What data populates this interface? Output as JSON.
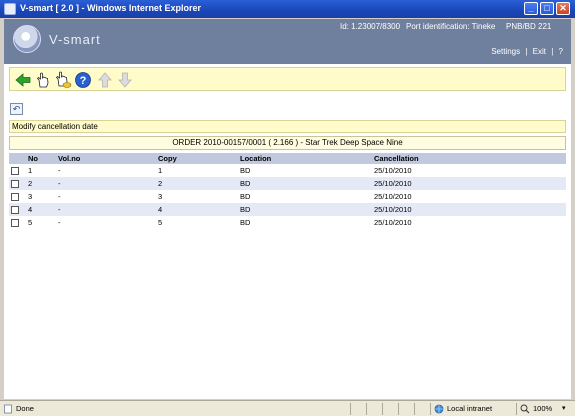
{
  "window": {
    "title": "V-smart [ 2.0 ] - Windows Internet Explorer",
    "controls": {
      "minimize": "_",
      "maximize": "□",
      "close": "✕"
    }
  },
  "banner": {
    "logo_text": "V-smart",
    "id_text": "Id: 1.23007/8300",
    "port_text": "Port identification: Tineke",
    "branch_text": "PNB/BD",
    "number_text": "221",
    "links": {
      "settings": "Settings",
      "exit": "Exit",
      "help": "?"
    },
    "separator": "|"
  },
  "toolbar": {
    "icons": [
      "back-arrow-icon",
      "hand-select-icon",
      "hand-select-all-icon",
      "help-icon",
      "up-arrow-icon",
      "down-arrow-icon"
    ]
  },
  "undo_label": "↶",
  "section_title": "Modify cancellation date",
  "order_line": "ORDER 2010-00157/0001 ( 2.166 ) - Star Trek Deep Space Nine",
  "table": {
    "headers": {
      "no": "No",
      "volno": "Vol.no",
      "copy": "Copy",
      "location": "Location",
      "cancellation": "Cancellation"
    },
    "rows": [
      {
        "no": "1",
        "volno": "-",
        "copy": "1",
        "location": "BD",
        "cancellation": "25/10/2010"
      },
      {
        "no": "2",
        "volno": "-",
        "copy": "2",
        "location": "BD",
        "cancellation": "25/10/2010"
      },
      {
        "no": "3",
        "volno": "-",
        "copy": "3",
        "location": "BD",
        "cancellation": "25/10/2010"
      },
      {
        "no": "4",
        "volno": "-",
        "copy": "4",
        "location": "BD",
        "cancellation": "25/10/2010"
      },
      {
        "no": "5",
        "volno": "-",
        "copy": "5",
        "location": "BD",
        "cancellation": "25/10/2010"
      }
    ]
  },
  "statusbar": {
    "status": "Done",
    "zone": "Local intranet",
    "zoom": "100%"
  }
}
